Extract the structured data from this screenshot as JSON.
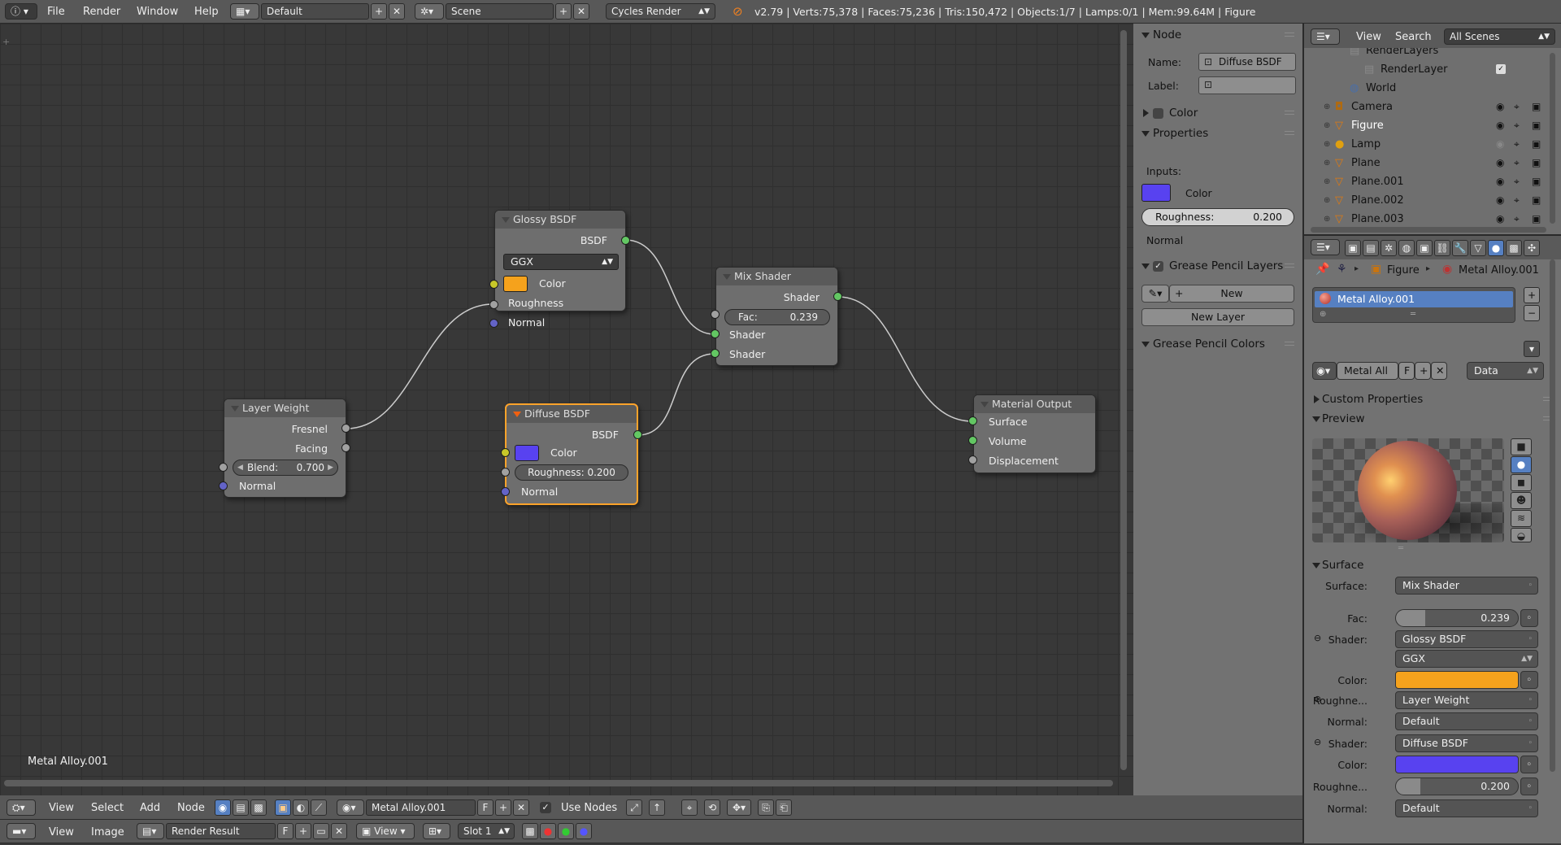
{
  "topbar": {
    "menus": [
      "File",
      "Render",
      "Window",
      "Help"
    ],
    "layout_name": "Default",
    "scene_name": "Scene",
    "engine": "Cycles Render",
    "stats": "v2.79 | Verts:75,378 | Faces:75,236 | Tris:150,472 | Objects:1/7 | Lamps:0/1 | Mem:99.64M | Figure"
  },
  "node_editor": {
    "material_label": "Metal Alloy.001",
    "nodes": {
      "glossy": {
        "title": "Glossy BSDF",
        "output": "BSDF",
        "distribution": "GGX",
        "color_label": "Color",
        "roughness_label": "Roughness",
        "normal_label": "Normal",
        "color": "#f5a21c"
      },
      "layer_weight": {
        "title": "Layer Weight",
        "fresnel": "Fresnel",
        "facing": "Facing",
        "blend_label": "Blend:",
        "blend_value": "0.700",
        "normal_label": "Normal"
      },
      "diffuse": {
        "title": "Diffuse BSDF",
        "output": "BSDF",
        "color_label": "Color",
        "roughness": "Roughness: 0.200",
        "normal_label": "Normal",
        "color": "#5842f0"
      },
      "mix": {
        "title": "Mix Shader",
        "output": "Shader",
        "fac_label": "Fac:",
        "fac_value": "0.239",
        "shader1": "Shader",
        "shader2": "Shader"
      },
      "output": {
        "title": "Material Output",
        "surface": "Surface",
        "volume": "Volume",
        "displacement": "Displacement"
      }
    }
  },
  "n_panel": {
    "node_section": "Node",
    "name_label": "Name:",
    "name_value": "Diffuse BSDF",
    "label_label": "Label:",
    "color_section": "Color",
    "properties_section": "Properties",
    "inputs_label": "Inputs:",
    "color_label": "Color",
    "roughness_label": "Roughness:",
    "roughness_value": "0.200",
    "normal_label": "Normal",
    "gp_layers_section": "Grease Pencil Layers",
    "new_button": "New",
    "new_layer_button": "New Layer",
    "gp_colors_section": "Grease Pencil Colors"
  },
  "outliner": {
    "view_menu": "View",
    "search_menu": "Search",
    "scenes_dropdown": "All Scenes",
    "items": [
      {
        "name": "RenderLayers",
        "indent": 2
      },
      {
        "name": "RenderLayer",
        "indent": 3
      },
      {
        "name": "World",
        "indent": 2
      },
      {
        "name": "Camera",
        "indent": 1
      },
      {
        "name": "Figure",
        "indent": 1
      },
      {
        "name": "Lamp",
        "indent": 1
      },
      {
        "name": "Plane",
        "indent": 1
      },
      {
        "name": "Plane.001",
        "indent": 1
      },
      {
        "name": "Plane.002",
        "indent": 1
      },
      {
        "name": "Plane.003",
        "indent": 1
      }
    ]
  },
  "properties": {
    "breadcrumb_object": "Figure",
    "breadcrumb_material": "Metal Alloy.001",
    "material_slot": "Metal Alloy.001",
    "material_field": "Metal All",
    "fake_user": "F",
    "link_dropdown": "Data",
    "custom_props": "Custom Properties",
    "preview": "Preview",
    "surface_section": "Surface",
    "rows": [
      {
        "label": "Surface:",
        "value": "Mix Shader",
        "kind": "dropdown"
      },
      {
        "label": "Fac:",
        "value": "0.239",
        "kind": "slider"
      },
      {
        "label": "Shader:",
        "value": "Glossy BSDF",
        "kind": "dropdown"
      },
      {
        "label": "",
        "value": "GGX",
        "kind": "select"
      },
      {
        "label": "Color:",
        "value": "",
        "kind": "color",
        "color": "#f5a21c"
      },
      {
        "label": "Roughne...",
        "value": "Layer Weight",
        "kind": "dropdown"
      },
      {
        "label": "Normal:",
        "value": "Default",
        "kind": "dropdown"
      },
      {
        "label": "Shader:",
        "value": "Diffuse BSDF",
        "kind": "dropdown"
      },
      {
        "label": "Color:",
        "value": "",
        "kind": "color",
        "color": "#5842f0"
      },
      {
        "label": "Roughne...",
        "value": "0.200",
        "kind": "slider"
      },
      {
        "label": "Normal:",
        "value": "Default",
        "kind": "dropdown"
      }
    ]
  },
  "bottom": {
    "menus1": [
      "View",
      "Select",
      "Add",
      "Node"
    ],
    "material_field": "Metal Alloy.001",
    "fake_user": "F",
    "use_nodes": "Use Nodes",
    "menus2": [
      "View",
      "Image"
    ],
    "image_field": "Render Result",
    "image_fake": "F",
    "view_menu": "View",
    "slot": "Slot 1"
  }
}
